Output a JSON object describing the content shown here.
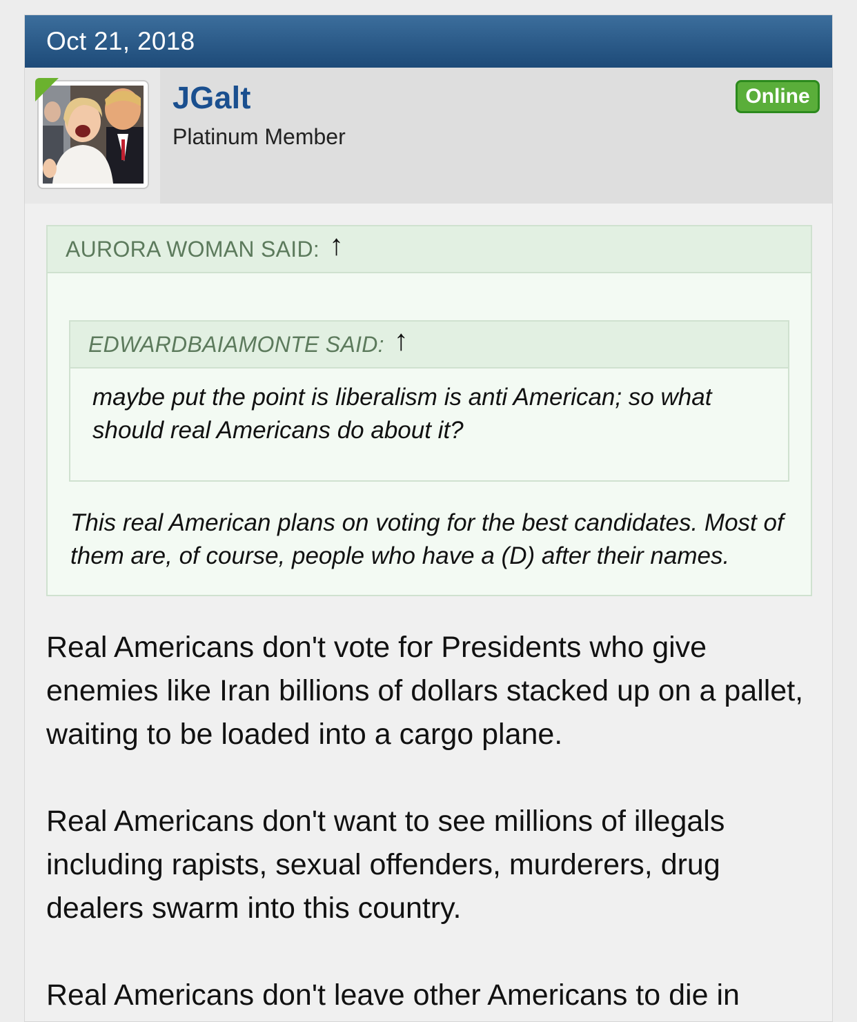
{
  "post": {
    "date": "Oct 21, 2018",
    "user": {
      "name": "JGalt",
      "title": "Platinum Member",
      "status": "Online",
      "avatar": "user-avatar-image"
    },
    "quote": {
      "author": "AURORA WOMAN SAID:",
      "nested_quote": {
        "author": "EDWARDBAIAMONTE SAID:",
        "text": "maybe put the point is liberalism is anti American; so what should real Americans do about it?"
      },
      "text": "This real American plans on voting for the best candidates. Most of them are, of course, people who have a (D) after their names."
    },
    "paragraphs": [
      "Real Americans don't vote for Presidents who give enemies like Iran billions of dollars stacked up on a pallet, waiting to be loaded into a cargo plane.",
      "Real Americans don't want to see millions of illegals including rapists, sexual offenders, murderers, drug dealers swarm into this country.",
      "Real Americans don't leave other Americans to die in"
    ]
  },
  "icons": {
    "jump_arrow": "↑",
    "online_corner": "online-indicator-icon"
  },
  "colors": {
    "header_bg": "#2a5a8a",
    "username": "#1a4f8f",
    "online_badge": "#5aae3a",
    "quote_bg": "#f3faf3",
    "quote_head_bg": "#e2f0e2",
    "quote_author": "#5c7a5c"
  }
}
